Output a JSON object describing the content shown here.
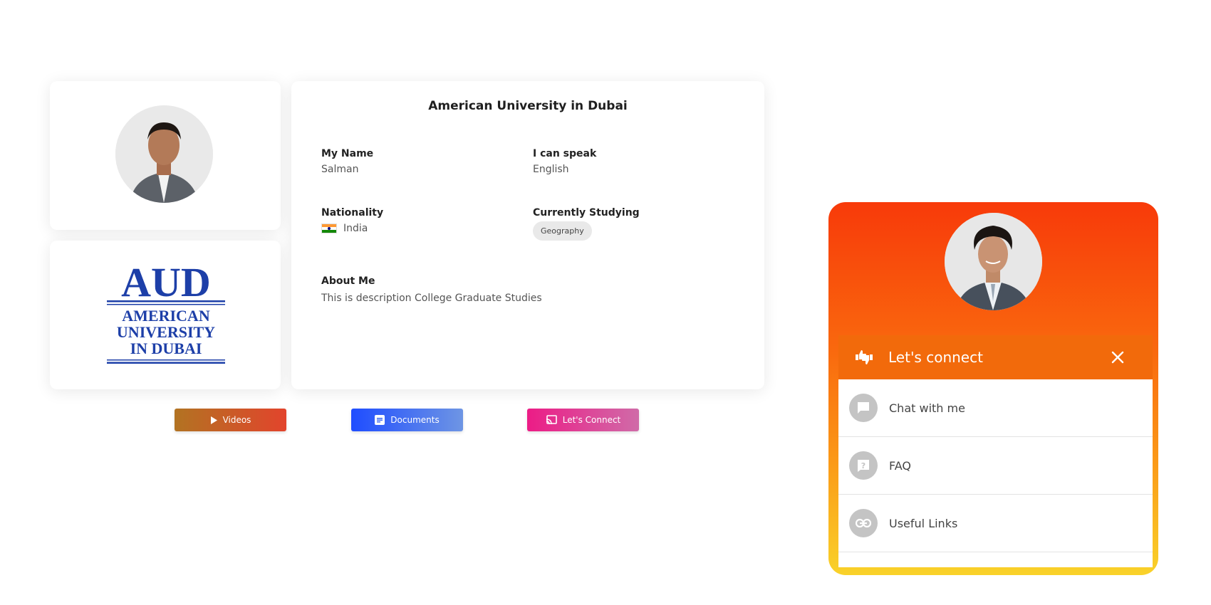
{
  "profile": {
    "university": "American University in Dubai",
    "name_label": "My Name",
    "name": "Salman",
    "speak_label": "I can speak",
    "speak": "English",
    "nationality_label": "Nationality",
    "nationality": "India",
    "studying_label": "Currently Studying",
    "studying": "Geography",
    "about_label": "About Me",
    "about": "This is description College Graduate Studies"
  },
  "logo": {
    "abbr": "AUD",
    "line1": "AMERICAN",
    "line2": "UNIVERSITY",
    "line3": "IN DUBAI",
    "color": "#1d3fa8"
  },
  "actions": {
    "videos": "Videos",
    "documents": "Documents",
    "connect": "Let's Connect"
  },
  "widget": {
    "title": "Let's connect",
    "items": [
      {
        "label": "Chat with me",
        "icon": "chat-icon"
      },
      {
        "label": "FAQ",
        "icon": "faq-icon"
      },
      {
        "label": "Useful Links",
        "icon": "link-icon"
      }
    ],
    "gradient_top": "#f83a0a",
    "gradient_bottom": "#f9d22a"
  }
}
